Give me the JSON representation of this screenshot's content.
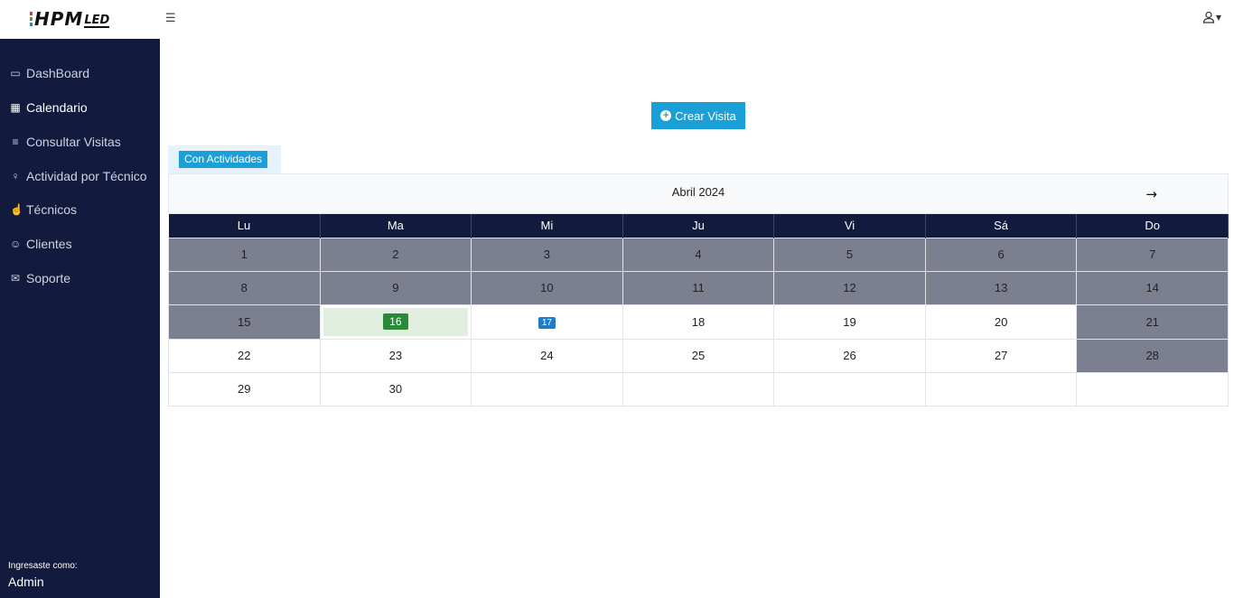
{
  "brand": {
    "name": "HPM",
    "suffix": "LED",
    "colors": [
      "#e53935",
      "#43a047",
      "#1e88e5"
    ]
  },
  "topbar": {
    "menu_icon": "hamburger-icon",
    "user_icon": "user-icon"
  },
  "sidebar": {
    "items": [
      {
        "label": "DashBoard",
        "icon": "folder-icon",
        "glyph": "🗀"
      },
      {
        "label": "Calendario",
        "icon": "calendar-icon",
        "glyph": "🗓"
      },
      {
        "label": "Consultar Visitas",
        "icon": "list-icon",
        "glyph": "☰"
      },
      {
        "label": "Actividad por Técnico",
        "icon": "lightbulb-icon",
        "glyph": "♀"
      },
      {
        "label": "Técnicos",
        "icon": "thumbs-up-icon",
        "glyph": "👍"
      },
      {
        "label": "Clientes",
        "icon": "smile-icon",
        "glyph": "☺"
      },
      {
        "label": "Soporte",
        "icon": "envelope-icon",
        "glyph": "✉"
      }
    ],
    "active_index": 1,
    "login_label": "Ingresaste como:",
    "login_user": "Admin"
  },
  "main": {
    "create_button": "Crear Visita",
    "tab_label": "Con Actividades"
  },
  "calendar": {
    "month_title": "Abril 2024",
    "next_icon": "arrow-right-icon",
    "weekdays": [
      "Lu",
      "Ma",
      "Mi",
      "Ju",
      "Vi",
      "Sá",
      "Do"
    ],
    "weeks": [
      [
        "1",
        "2",
        "3",
        "4",
        "5",
        "6",
        "7"
      ],
      [
        "8",
        "9",
        "10",
        "11",
        "12",
        "13",
        "14"
      ],
      [
        "15",
        "16",
        "17",
        "18",
        "19",
        "20",
        "21"
      ],
      [
        "22",
        "23",
        "24",
        "25",
        "26",
        "27",
        "28"
      ],
      [
        "29",
        "30",
        "",
        "",
        "",
        "",
        ""
      ]
    ],
    "today": "16",
    "highlighted": "17",
    "colors": {
      "header": "#121a3d",
      "past": "#7c7f90",
      "today_badge": "#2a8a3c",
      "today_bg": "#e1efe0",
      "highlight_badge": "#1e7bc8",
      "accent": "#1aa0d6"
    }
  }
}
